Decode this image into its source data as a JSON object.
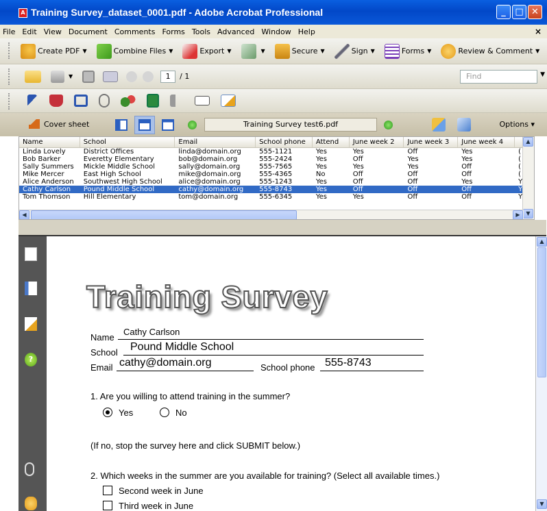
{
  "window": {
    "title": "Training Survey_dataset_0001.pdf - Adobe Acrobat Professional"
  },
  "menu": [
    "File",
    "Edit",
    "View",
    "Document",
    "Comments",
    "Forms",
    "Tools",
    "Advanced",
    "Window",
    "Help"
  ],
  "toolbar": {
    "create_pdf": "Create PDF",
    "combine_files": "Combine Files",
    "export": "Export",
    "secure": "Secure",
    "sign": "Sign",
    "forms": "Forms",
    "review": "Review & Comment"
  },
  "nav": {
    "page_current": "1",
    "page_total": "/ 1",
    "find_placeholder": "Find"
  },
  "portfolio": {
    "cover_label": "Cover sheet",
    "file_name": "Training Survey test6.pdf",
    "options_label": "Options"
  },
  "list": {
    "columns": [
      "Name",
      "School",
      "Email",
      "School phone",
      "Attend",
      "June week 2",
      "June week 3",
      "June week 4",
      ""
    ],
    "rows": [
      [
        "Linda Lovely",
        "District Offices",
        "linda@domain.org",
        "555-1121",
        "Yes",
        "Yes",
        "Off",
        "Yes",
        "("
      ],
      [
        "Bob Barker",
        "Everetty Elementary",
        "bob@domain.org",
        "555-2424",
        "Yes",
        "Off",
        "Yes",
        "Yes",
        "("
      ],
      [
        "Sally Summers",
        "Mickle Middle School",
        "sally@domain.org",
        "555-7565",
        "Yes",
        "Yes",
        "Yes",
        "Off",
        "("
      ],
      [
        "Mike Mercer",
        "East High School",
        "mike@domain.org",
        "555-4365",
        "No",
        "Off",
        "Off",
        "Off",
        "("
      ],
      [
        "Alice Anderson",
        "Southwest High School",
        "alice@domain.org",
        "555-1243",
        "Yes",
        "Off",
        "Off",
        "Yes",
        "Y"
      ],
      [
        "Cathy Carlson",
        "Pound Middle School",
        "cathy@domain.org",
        "555-8743",
        "Yes",
        "Off",
        "Off",
        "Off",
        "Y"
      ],
      [
        "Tom Thomson",
        "Hill Elementary",
        "tom@domain.org",
        "555-6345",
        "Yes",
        "Yes",
        "Off",
        "Off",
        "Y"
      ]
    ],
    "selected_index": 5
  },
  "form": {
    "title": "Training Survey",
    "name_label": "Name",
    "name_value": "Cathy Carlson",
    "school_label": "School",
    "school_value": "Pound Middle School",
    "email_label": "Email",
    "email_value": "cathy@domain.org",
    "phone_label": "School phone",
    "phone_value": "555-8743",
    "q1": "1. Are you willing to attend training in the summer?",
    "q1_yes": "Yes",
    "q1_no": "No",
    "q1_selected": "Yes",
    "note": "(If no, stop the survey here and click SUBMIT below.)",
    "q2": "2. Which weeks in the summer are you available for training? (Select all available times.)",
    "q2_options": [
      "Second week in June",
      "Third week in June"
    ]
  },
  "colors": {
    "title_bar": "#0a5fe0",
    "selection": "#316ac5",
    "side_panel": "#555555"
  }
}
